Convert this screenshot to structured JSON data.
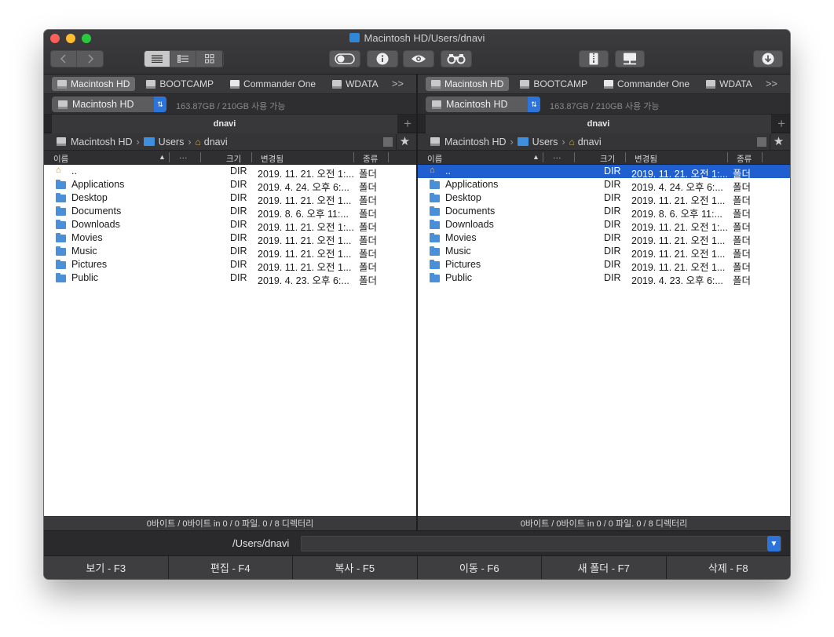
{
  "window": {
    "title": "Macintosh HD/Users/dnavi"
  },
  "toolbar": {
    "back_icon": "chevron-left-icon",
    "forward_icon": "chevron-right-icon",
    "view_modes": [
      "list-view-icon",
      "detail-list-icon",
      "grid-view-icon"
    ],
    "buttons": [
      "toggle-hidden-icon",
      "info-icon",
      "eye-icon",
      "binoculars-icon",
      "archive-icon",
      "network-icon",
      "download-icon"
    ]
  },
  "panels": [
    {
      "drives": [
        "Macintosh HD",
        "BOOTCAMP",
        "Commander One",
        "WDATA"
      ],
      "more": ">>",
      "volume": "Macintosh HD",
      "free": "163.87GB / 210GB 사용 가능",
      "tab": "dnavi",
      "path": {
        "root": "Macintosh HD",
        "folder": "Users",
        "home": "dnavi",
        "sep": "›"
      },
      "columns": {
        "name": "이름",
        "ext": "···",
        "size": "크기",
        "modified": "변경됨",
        "kind": "종류"
      },
      "selected": -1,
      "rows": [
        {
          "name": "..",
          "size": "DIR",
          "date": "2019. 11. 21. 오전 1:...",
          "kind": "폴더"
        },
        {
          "name": "Applications",
          "size": "DIR",
          "date": "2019. 4. 24. 오후 6:...",
          "kind": "폴더"
        },
        {
          "name": "Desktop",
          "size": "DIR",
          "date": "2019. 11. 21. 오전 1...",
          "kind": "폴더"
        },
        {
          "name": "Documents",
          "size": "DIR",
          "date": "2019. 8. 6. 오후 11:...",
          "kind": "폴더"
        },
        {
          "name": "Downloads",
          "size": "DIR",
          "date": "2019. 11. 21. 오전 1:...",
          "kind": "폴더"
        },
        {
          "name": "Movies",
          "size": "DIR",
          "date": "2019. 11. 21. 오전 1...",
          "kind": "폴더"
        },
        {
          "name": "Music",
          "size": "DIR",
          "date": "2019. 11. 21. 오전 1...",
          "kind": "폴더"
        },
        {
          "name": "Pictures",
          "size": "DIR",
          "date": "2019. 11. 21. 오전 1...",
          "kind": "폴더"
        },
        {
          "name": "Public",
          "size": "DIR",
          "date": "2019. 4. 23. 오후 6:...",
          "kind": "폴더"
        }
      ],
      "status": "0바이트 / 0바이트 in 0 / 0 파일. 0 / 8 디렉터리"
    },
    {
      "drives": [
        "Macintosh HD",
        "BOOTCAMP",
        "Commander One",
        "WDATA"
      ],
      "more": ">>",
      "volume": "Macintosh HD",
      "free": "163.87GB / 210GB 사용 가능",
      "tab": "dnavi",
      "path": {
        "root": "Macintosh HD",
        "folder": "Users",
        "home": "dnavi",
        "sep": "›"
      },
      "columns": {
        "name": "이름",
        "ext": "···",
        "size": "크기",
        "modified": "변경됨",
        "kind": "종류"
      },
      "selected": 0,
      "rows": [
        {
          "name": "..",
          "size": "DIR",
          "date": "2019. 11. 21. 오전 1:...",
          "kind": "폴더"
        },
        {
          "name": "Applications",
          "size": "DIR",
          "date": "2019. 4. 24. 오후 6:...",
          "kind": "폴더"
        },
        {
          "name": "Desktop",
          "size": "DIR",
          "date": "2019. 11. 21. 오전 1...",
          "kind": "폴더"
        },
        {
          "name": "Documents",
          "size": "DIR",
          "date": "2019. 8. 6. 오후 11:...",
          "kind": "폴더"
        },
        {
          "name": "Downloads",
          "size": "DIR",
          "date": "2019. 11. 21. 오전 1:...",
          "kind": "폴더"
        },
        {
          "name": "Movies",
          "size": "DIR",
          "date": "2019. 11. 21. 오전 1...",
          "kind": "폴더"
        },
        {
          "name": "Music",
          "size": "DIR",
          "date": "2019. 11. 21. 오전 1...",
          "kind": "폴더"
        },
        {
          "name": "Pictures",
          "size": "DIR",
          "date": "2019. 11. 21. 오전 1...",
          "kind": "폴더"
        },
        {
          "name": "Public",
          "size": "DIR",
          "date": "2019. 4. 23. 오후 6:...",
          "kind": "폴더"
        }
      ],
      "status": "0바이트 / 0바이트 in 0 / 0 파일. 0 / 8 디렉터리"
    }
  ],
  "command": {
    "path": "/Users/dnavi",
    "value": ""
  },
  "fkeys": [
    "보기 - F3",
    "편집 - F4",
    "복사 - F5",
    "이동 - F6",
    "새 폴더 - F7",
    "삭제 - F8"
  ],
  "colors": {
    "selection": "#1f5fd0",
    "accent": "#2d74da",
    "folder": "#4a90d9"
  }
}
